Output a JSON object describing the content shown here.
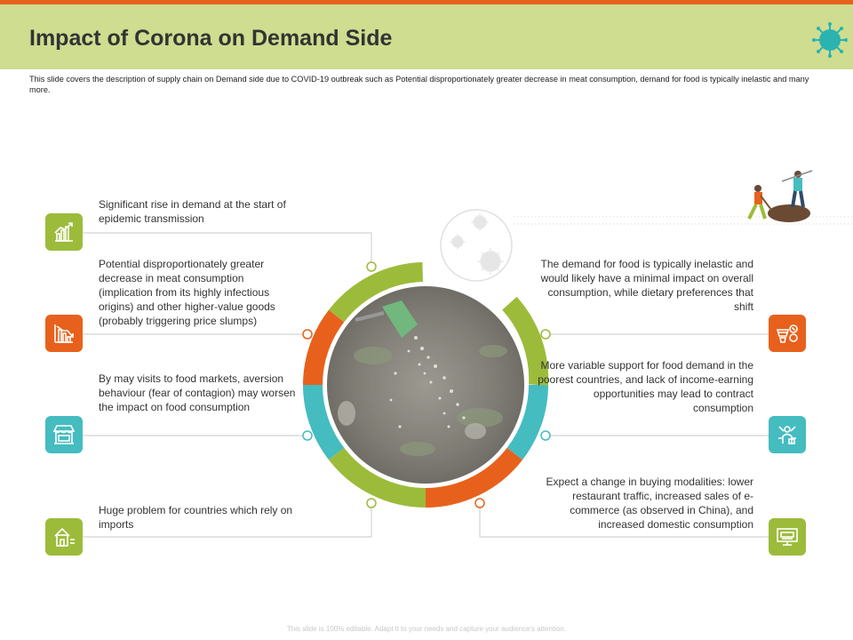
{
  "slide": {
    "title": "Impact of Corona on Demand Side",
    "description": "This slide covers the description of supply chain on Demand  side due to COVID-19  outbreak such as Potential  disproportionately greater decrease in meat consumption, demand  for food is typically inelastic and many more.",
    "footer": "This slide is 100% editable. Adapt it to your needs and capture your audience's attention."
  },
  "colors": {
    "accent_orange": "#e8611c",
    "header_green": "#cedd8f",
    "green": "#9dbb3a",
    "teal": "#45bcc0"
  },
  "left_items": [
    {
      "text": "Significant rise in demand at the start of epidemic transmission",
      "icon": "growth-chart-icon",
      "color": "green"
    },
    {
      "text": "Potential disproportionately greater decrease in meat consumption (implication from its highly infectious origins) and other higher-value  goods (probably triggering price slumps)",
      "icon": "declining-chart-icon",
      "color": "orange"
    },
    {
      "text": "By may visits to food markets, aversion behaviour  (fear of contagion) may worsen the impact on food consumption",
      "icon": "market-stall-icon",
      "color": "teal"
    },
    {
      "text": "Huge problem for countries which rely on imports",
      "icon": "house-import-icon",
      "color": "green"
    }
  ],
  "right_items": [
    {
      "text": "The demand for food is typically inelastic and would likely have a minimal impact on overall consumption, while dietary preferences  that shift",
      "icon": "food-demand-icon",
      "color": "orange"
    },
    {
      "text": "More variable  support for food demand in the poorest countries, and lack of income-earning opportunities may lead to contract consumption",
      "icon": "network-person-icon",
      "color": "teal"
    },
    {
      "text": "Expect a change in buying modalities: lower restaurant traffic, increased sales of e-commerce (as observed  in China), and increased domestic consumption",
      "icon": "ecommerce-monitor-icon",
      "color": "green"
    }
  ]
}
